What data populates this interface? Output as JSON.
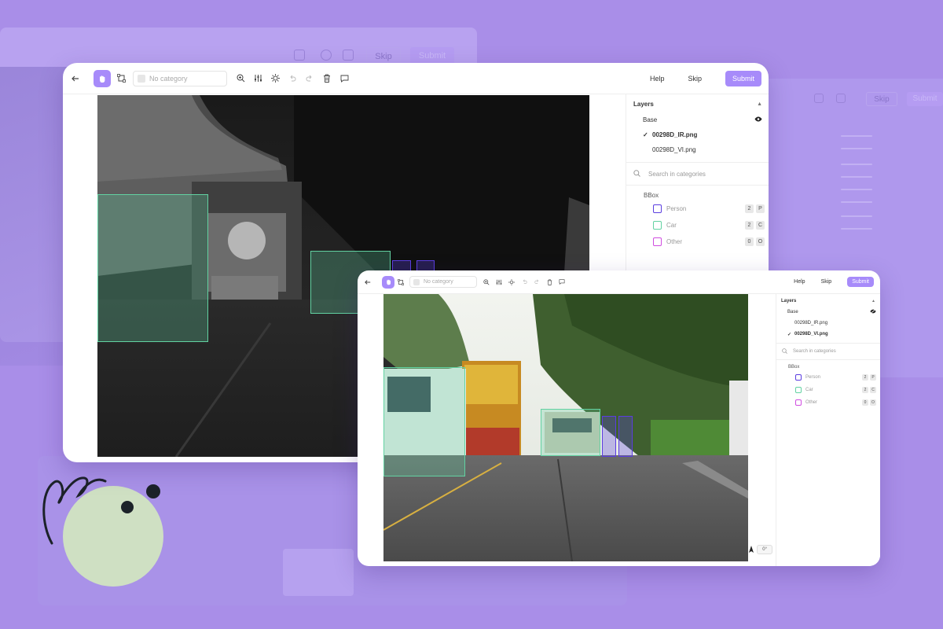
{
  "colors": {
    "accent": "#a78bfa",
    "person": "#5b3ee0",
    "car": "#62d2a2",
    "other": "#d04de0",
    "background": "#a98ee8"
  },
  "ghost": {
    "skip_label": "Skip",
    "submit_label": "Submit"
  },
  "toolbar": {
    "category_placeholder": "No category",
    "help_label": "Help",
    "skip_label": "Skip",
    "submit_label": "Submit",
    "icons": [
      "back-arrow-icon",
      "hand-pan-icon",
      "bbox-tool-icon",
      "zoom-in-icon",
      "sliders-icon",
      "brightness-icon",
      "undo-icon",
      "redo-icon",
      "trash-icon",
      "comment-icon"
    ]
  },
  "sidebar": {
    "layers_title": "Layers",
    "base_label": "Base",
    "files": [
      {
        "name": "00298D_IR.png"
      },
      {
        "name": "00298D_VI.png"
      }
    ],
    "search_placeholder": "Search in categories",
    "group_label": "BBox",
    "categories": [
      {
        "name": "Person",
        "keys": [
          "2",
          "P"
        ]
      },
      {
        "name": "Car",
        "keys": [
          "2",
          "C"
        ]
      },
      {
        "name": "Other",
        "keys": [
          "0",
          "O"
        ]
      }
    ]
  },
  "window_ir": {
    "selected_file_index": 0
  },
  "window_vi": {
    "selected_file_index": 1,
    "rotation_value": "0°"
  }
}
